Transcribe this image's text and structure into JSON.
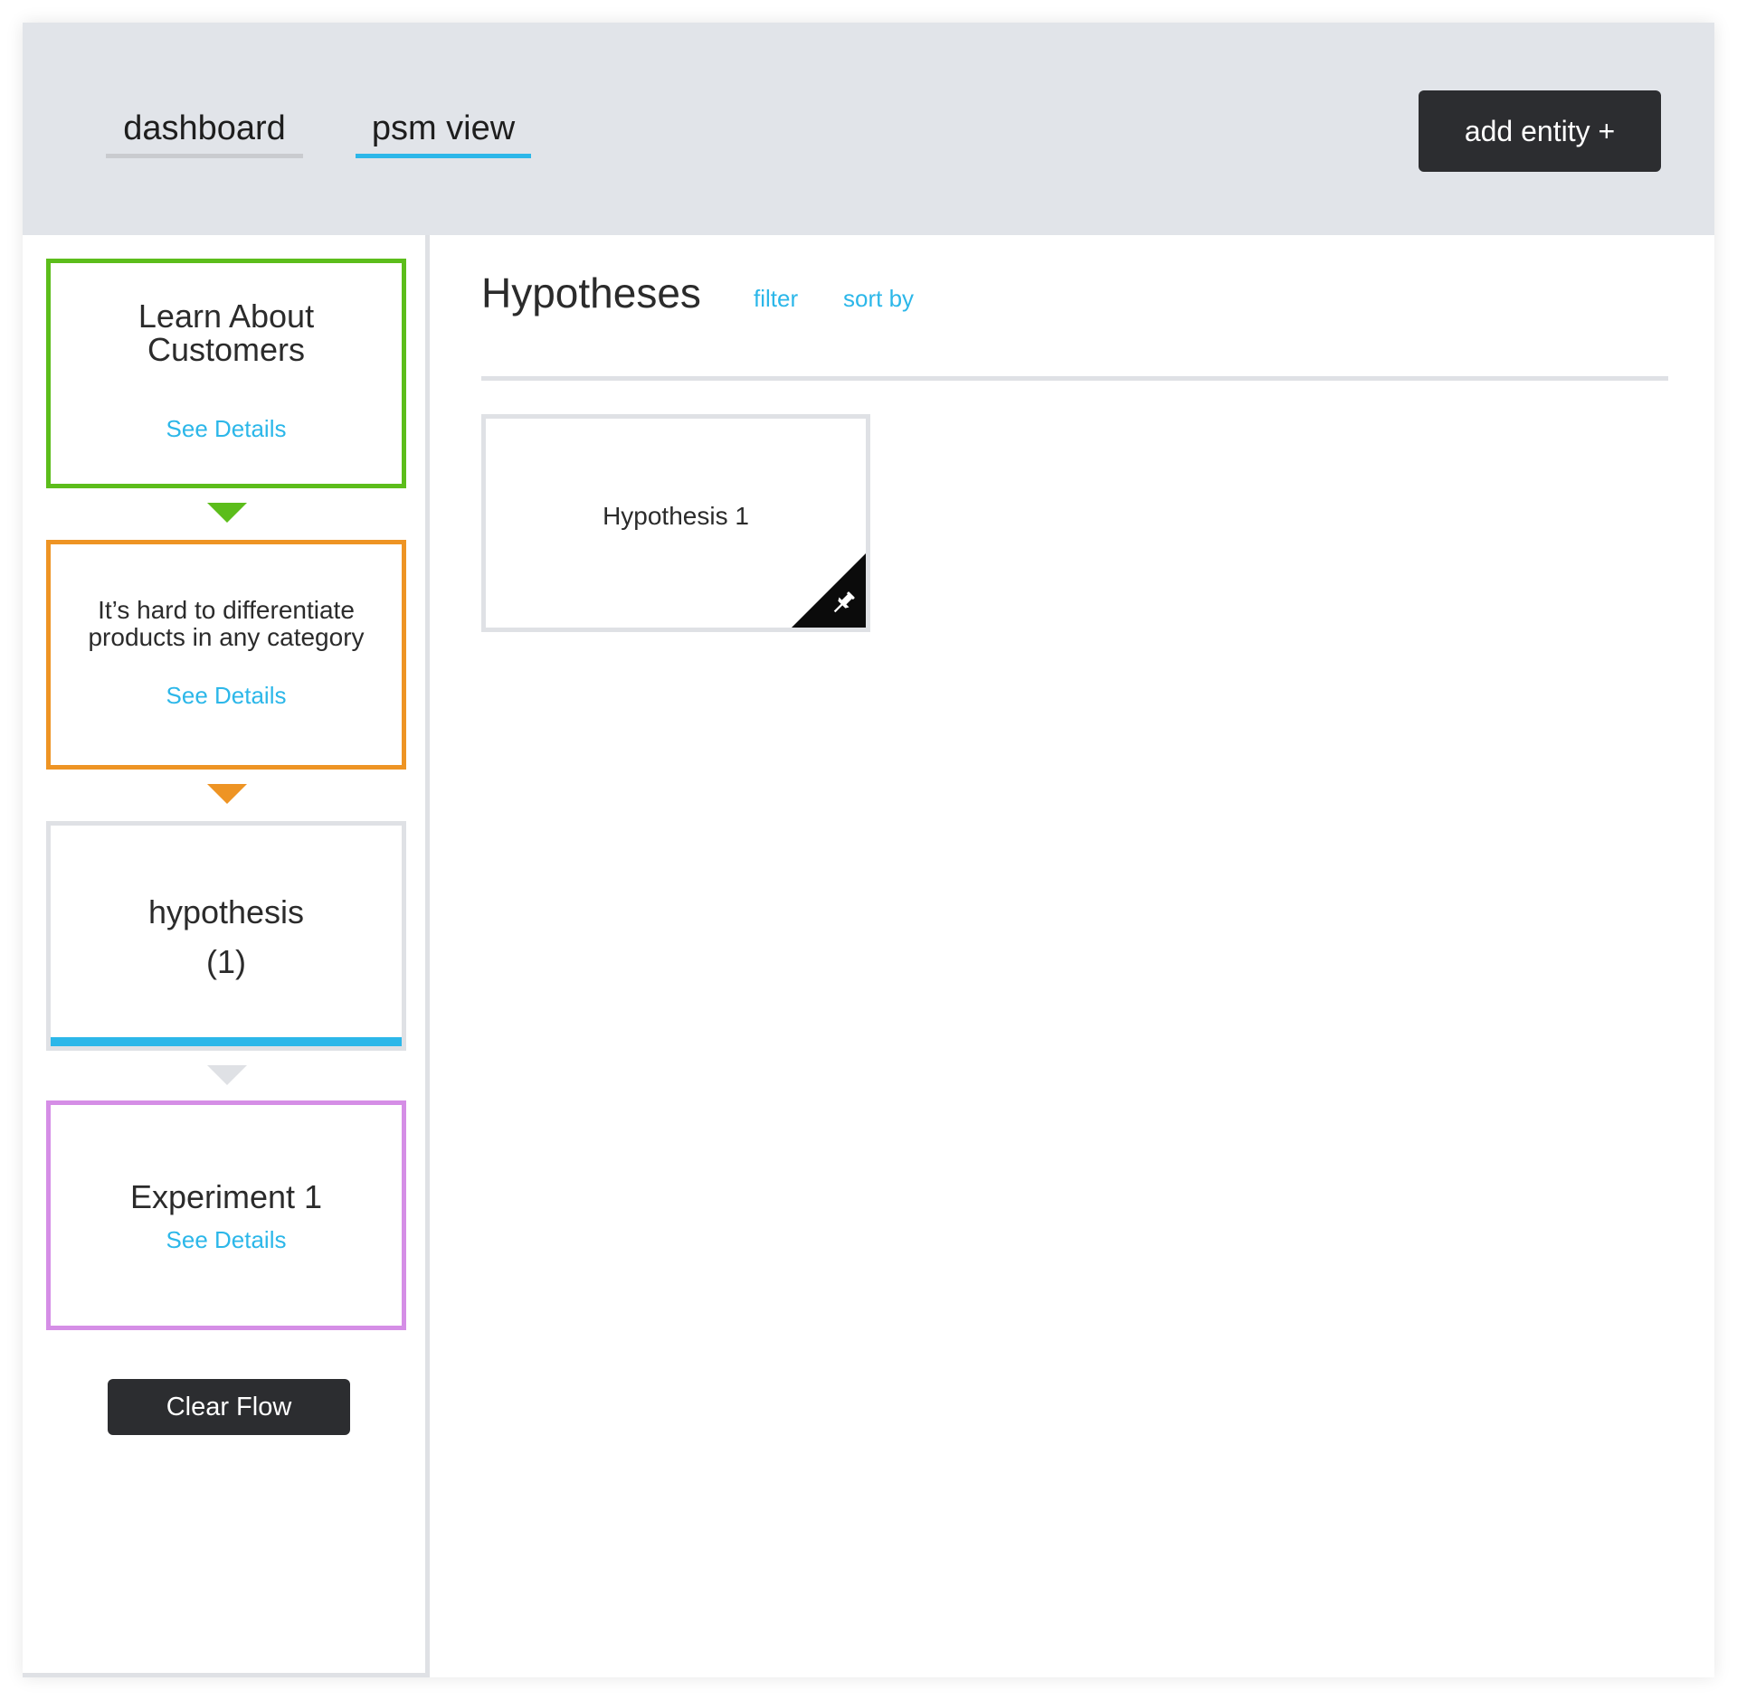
{
  "header": {
    "tabs": [
      {
        "label": "dashboard",
        "active": false
      },
      {
        "label": "psm view",
        "active": true
      }
    ],
    "add_entity_label": "add entity +"
  },
  "sidebar": {
    "flow": [
      {
        "title_lines": [
          "Learn About",
          "Customers"
        ],
        "link": "See Details",
        "border_color": "#5cbd1b"
      },
      {
        "title_lines": [
          "It’s hard to differentiate",
          "products in any category"
        ],
        "link": "See Details",
        "border_color": "#ee9424"
      },
      {
        "title_lines": [
          "hypothesis",
          "(1)"
        ],
        "border_color": "#dfe1e5",
        "active_color": "#2cb7e9"
      },
      {
        "title_lines": [
          "Experiment 1"
        ],
        "link": "See Details",
        "border_color": "#d58ee6"
      }
    ],
    "clear_flow_label": "Clear Flow"
  },
  "main": {
    "title": "Hypotheses",
    "filter_label": "filter",
    "sort_label": "sort by",
    "cards": [
      {
        "title": "Hypothesis 1",
        "icon": "pin-icon"
      }
    ]
  },
  "colors": {
    "accent": "#2cb7e9",
    "header_bg": "#e1e4e9",
    "button_bg": "#2c2d30",
    "divider": "#dfe1e5"
  }
}
